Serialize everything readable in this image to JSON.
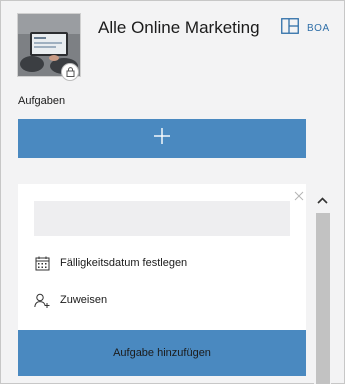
{
  "header": {
    "title": "Alle Online Marketing",
    "avatar_icon": "group-photo",
    "lock_icon": "lock-icon",
    "board_tab_label": "BOA",
    "board_tab_icon": "board-view-icon"
  },
  "tasks": {
    "section_label": "Aufgaben",
    "add_button_icon": "plus-icon"
  },
  "new_task_card": {
    "title_input_value": "",
    "due_date_label": "Fälligkeitsdatum festlegen",
    "due_date_icon": "calendar-icon",
    "assign_label": "Zuweisen",
    "assign_icon": "add-person-icon",
    "submit_label": "Aufgabe hinzufügen",
    "close_icon": "close-icon"
  },
  "colors": {
    "accent": "#4a89c0",
    "background": "#f3f3f4",
    "card": "#ffffff",
    "input_bg": "#eeeef0"
  }
}
